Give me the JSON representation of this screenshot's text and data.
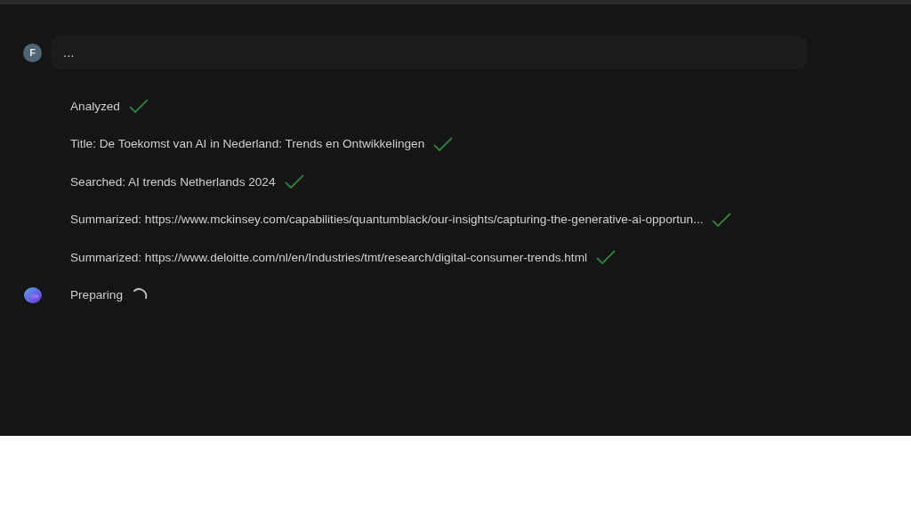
{
  "user_message": {
    "avatar": "F",
    "text": "..."
  },
  "steps": [
    {
      "text": "Analyzed",
      "done": true
    },
    {
      "text": "Title: De Toekomst van AI in Nederland: Trends en Ontwikkelingen",
      "done": true
    },
    {
      "text": "Searched: AI trends Netherlands 2024",
      "done": true
    },
    {
      "text": "Summarized: https://www.mckinsey.com/capabilities/quantumblack/our-insights/capturing-the-generative-ai-opportun...",
      "done": true
    },
    {
      "text": "Summarized: https://www.deloitte.com/nl/en/Industries/tmt/research/digital-consumer-trends.html",
      "done": true
    },
    {
      "text": "Preparing",
      "done": false
    }
  ]
}
